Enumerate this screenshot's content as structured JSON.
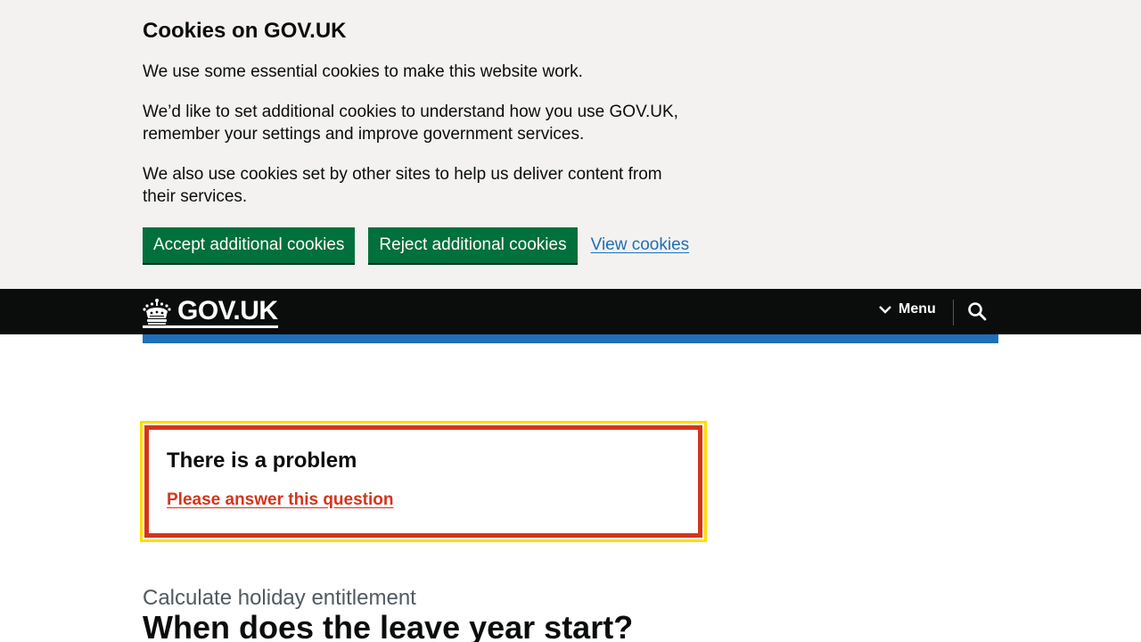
{
  "cookie_banner": {
    "title": "Cookies on GOV.UK",
    "paragraphs": [
      "We use some essential cookies to make this website work.",
      "We’d like to set additional cookies to understand how you use GOV.UK, remember your settings and improve government services.",
      "We also use cookies set by other sites to help us deliver content from their services."
    ],
    "accept_label": "Accept additional cookies",
    "reject_label": "Reject additional cookies",
    "view_label": "View cookies"
  },
  "header": {
    "logo_text": "GOV.UK",
    "menu_label": "Menu",
    "logo_icon": "crown-icon",
    "menu_icon": "chevron-down-icon",
    "search_icon": "search-icon"
  },
  "error_summary": {
    "title": "There is a problem",
    "items": [
      "Please answer this question"
    ]
  },
  "main": {
    "caption": "Calculate holiday entitlement",
    "title": "When does the leave year start?"
  },
  "colors": {
    "button_green": "#00703c",
    "link_blue": "#1d70b8",
    "error_red": "#d4351c",
    "focus_yellow": "#ffdd00",
    "header_black": "#0b0c0c",
    "banner_grey": "#f3f2f1"
  }
}
